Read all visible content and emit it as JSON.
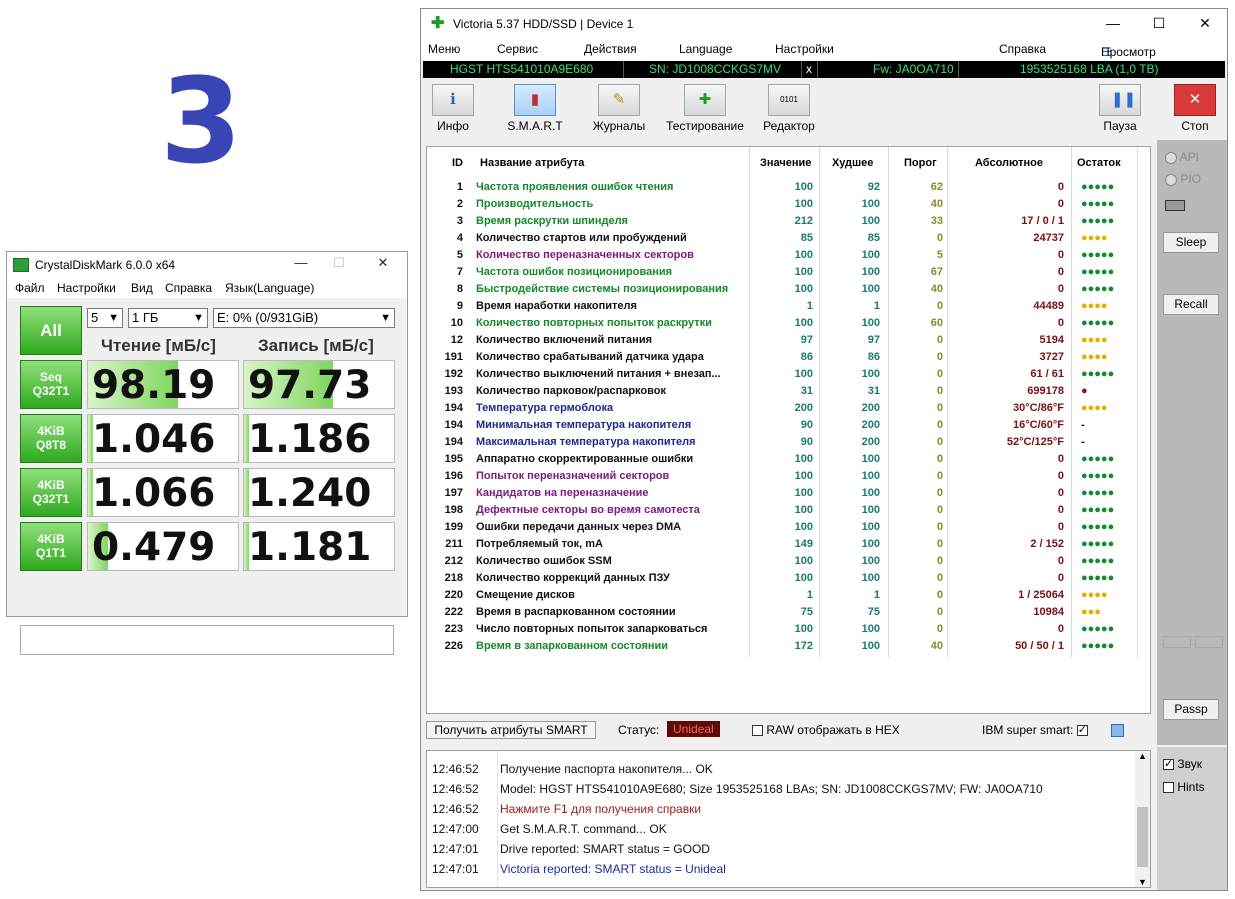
{
  "overlay_number": "3",
  "cdm": {
    "title": "CrystalDiskMark 6.0.0 x64",
    "menu": [
      "Файл",
      "Настройки",
      "Вид",
      "Справка",
      "Язык(Language)"
    ],
    "all_label": "All",
    "count": "5",
    "size": "1 ГБ",
    "drive": "E: 0% (0/931GiB)",
    "read_header": "Чтение [мБ/с]",
    "write_header": "Запись [мБ/с]",
    "rows": [
      {
        "label1": "Seq",
        "label2": "Q32T1",
        "read": "98.19",
        "write": "97.73",
        "read_fill": 0.6,
        "write_fill": 0.59
      },
      {
        "label1": "4KiB",
        "label2": "Q8T8",
        "read": "1.046",
        "write": "1.186",
        "read_fill": 0.03,
        "write_fill": 0.03
      },
      {
        "label1": "4KiB",
        "label2": "Q32T1",
        "read": "1.066",
        "write": "1.240",
        "read_fill": 0.03,
        "write_fill": 0.03
      },
      {
        "label1": "4KiB",
        "label2": "Q1T1",
        "read": "0.479",
        "write": "1.181",
        "read_fill": 0.13,
        "write_fill": 0.03
      }
    ]
  },
  "victoria": {
    "title": "Victoria 5.37 HDD/SSD | Device 1",
    "menu": [
      "Меню",
      "Сервис",
      "Действия",
      "Language",
      "Настройки",
      "Справка"
    ],
    "buffer_view": "Просмотр буфера",
    "drive_model": "HGST HTS541010A9E680",
    "serial": "SN: JD1008CCKGS7MV",
    "close_x": "x",
    "firmware": "Fw: JA0OA710",
    "lba": "1953525168 LBA (1,0 TB)",
    "toolbar": {
      "info": "Инфо",
      "smart": "S.M.A.R.T",
      "logs": "Журналы",
      "test": "Тестирование",
      "editor": "Редактор",
      "pause": "Пауза",
      "stop": "Стоп"
    },
    "columns": [
      "ID",
      "Название атрибута",
      "Значение",
      "Худшее",
      "Порог",
      "Абсолютное",
      "Остаток"
    ],
    "attributes": [
      {
        "id": "1",
        "name": "Частота проявления ошибок чтения",
        "value": "100",
        "worst": "92",
        "thr": "62",
        "abs": "0",
        "rem": "●●●●●",
        "color": "#148a2c",
        "remc": "dots-green"
      },
      {
        "id": "2",
        "name": "Производительность",
        "value": "100",
        "worst": "100",
        "thr": "40",
        "abs": "0",
        "rem": "●●●●●",
        "color": "#148a2c",
        "remc": "dots-green"
      },
      {
        "id": "3",
        "name": "Время раскрутки шпинделя",
        "value": "212",
        "worst": "100",
        "thr": "33",
        "abs": "17 / 0 / 1",
        "rem": "●●●●●",
        "color": "#148a2c",
        "remc": "dots-green"
      },
      {
        "id": "4",
        "name": "Количество стартов или пробуждений",
        "value": "85",
        "worst": "85",
        "thr": "0",
        "abs": "24737",
        "rem": "●●●●",
        "color": "#111111",
        "remc": "dots-yellow"
      },
      {
        "id": "5",
        "name": "Количество переназначенных секторов",
        "value": "100",
        "worst": "100",
        "thr": "5",
        "abs": "0",
        "rem": "●●●●●",
        "color": "#7a1c7a",
        "remc": "dots-green"
      },
      {
        "id": "7",
        "name": "Частота ошибок позиционирования",
        "value": "100",
        "worst": "100",
        "thr": "67",
        "abs": "0",
        "rem": "●●●●●",
        "color": "#148a2c",
        "remc": "dots-green"
      },
      {
        "id": "8",
        "name": "Быстродействие системы позиционирования",
        "value": "100",
        "worst": "100",
        "thr": "40",
        "abs": "0",
        "rem": "●●●●●",
        "color": "#148a2c",
        "remc": "dots-green"
      },
      {
        "id": "9",
        "name": "Время наработки накопителя",
        "value": "1",
        "worst": "1",
        "thr": "0",
        "abs": "44489",
        "rem": "●●●●",
        "color": "#111111",
        "remc": "dots-yellow"
      },
      {
        "id": "10",
        "name": "Количество повторных попыток раскрутки",
        "value": "100",
        "worst": "100",
        "thr": "60",
        "abs": "0",
        "rem": "●●●●●",
        "color": "#148a2c",
        "remc": "dots-green"
      },
      {
        "id": "12",
        "name": "Количество включений питания",
        "value": "97",
        "worst": "97",
        "thr": "0",
        "abs": "5194",
        "rem": "●●●●",
        "color": "#111111",
        "remc": "dots-yellow"
      },
      {
        "id": "191",
        "name": "Количество срабатываний датчика удара",
        "value": "86",
        "worst": "86",
        "thr": "0",
        "abs": "3727",
        "rem": "●●●●",
        "color": "#111111",
        "remc": "dots-yellow"
      },
      {
        "id": "192",
        "name": "Количество выключений питания + внезап...",
        "value": "100",
        "worst": "100",
        "thr": "0",
        "abs": "61 / 61",
        "rem": "●●●●●",
        "color": "#111111",
        "remc": "dots-green"
      },
      {
        "id": "193",
        "name": "Количество парковок/распарковок",
        "value": "31",
        "worst": "31",
        "thr": "0",
        "abs": "699178",
        "rem": "●",
        "color": "#111111",
        "remc": "dots-red"
      },
      {
        "id": "194",
        "name": "Температура гермоблока",
        "value": "200",
        "worst": "200",
        "thr": "0",
        "abs": "30°C/86°F",
        "rem": "●●●●",
        "color": "#1e2a8a",
        "remc": "dots-yellow"
      },
      {
        "id": "194",
        "name": "Минимальная температура накопителя",
        "value": "90",
        "worst": "200",
        "thr": "0",
        "abs": "16°C/60°F",
        "rem": "-",
        "color": "#1e2a8a",
        "remc": "dots-plain"
      },
      {
        "id": "194",
        "name": "Максимальная температура накопителя",
        "value": "90",
        "worst": "200",
        "thr": "0",
        "abs": "52°C/125°F",
        "rem": "-",
        "color": "#1e2a8a",
        "remc": "dots-plain"
      },
      {
        "id": "195",
        "name": "Аппаратно скорректированные ошибки",
        "value": "100",
        "worst": "100",
        "thr": "0",
        "abs": "0",
        "rem": "●●●●●",
        "color": "#111111",
        "remc": "dots-green"
      },
      {
        "id": "196",
        "name": "Попыток переназначений секторов",
        "value": "100",
        "worst": "100",
        "thr": "0",
        "abs": "0",
        "rem": "●●●●●",
        "color": "#7a1c7a",
        "remc": "dots-green"
      },
      {
        "id": "197",
        "name": "Кандидатов на переназначение",
        "value": "100",
        "worst": "100",
        "thr": "0",
        "abs": "0",
        "rem": "●●●●●",
        "color": "#7a1c7a",
        "remc": "dots-green"
      },
      {
        "id": "198",
        "name": "Дефектные секторы во время самотеста",
        "value": "100",
        "worst": "100",
        "thr": "0",
        "abs": "0",
        "rem": "●●●●●",
        "color": "#7a1c7a",
        "remc": "dots-green"
      },
      {
        "id": "199",
        "name": "Ошибки передачи данных через DMA",
        "value": "100",
        "worst": "100",
        "thr": "0",
        "abs": "0",
        "rem": "●●●●●",
        "color": "#111111",
        "remc": "dots-green"
      },
      {
        "id": "211",
        "name": "Потребляемый ток, mA",
        "value": "149",
        "worst": "100",
        "thr": "0",
        "abs": "2 / 152",
        "rem": "●●●●●",
        "color": "#111111",
        "remc": "dots-green"
      },
      {
        "id": "212",
        "name": "Количество ошибок SSM",
        "value": "100",
        "worst": "100",
        "thr": "0",
        "abs": "0",
        "rem": "●●●●●",
        "color": "#111111",
        "remc": "dots-green"
      },
      {
        "id": "218",
        "name": "Количество коррекций данных ПЗУ",
        "value": "100",
        "worst": "100",
        "thr": "0",
        "abs": "0",
        "rem": "●●●●●",
        "color": "#111111",
        "remc": "dots-green"
      },
      {
        "id": "220",
        "name": "Смещение дисков",
        "value": "1",
        "worst": "1",
        "thr": "0",
        "abs": "1 / 25064",
        "rem": "●●●●",
        "color": "#111111",
        "remc": "dots-yellow"
      },
      {
        "id": "222",
        "name": "Время в распаркованном состоянии",
        "value": "75",
        "worst": "75",
        "thr": "0",
        "abs": "10984",
        "rem": "●●●",
        "color": "#111111",
        "remc": "dots-yellow"
      },
      {
        "id": "223",
        "name": "Число повторных попыток запарковаться",
        "value": "100",
        "worst": "100",
        "thr": "0",
        "abs": "0",
        "rem": "●●●●●",
        "color": "#111111",
        "remc": "dots-green"
      },
      {
        "id": "226",
        "name": "Время в запаркованном состоянии",
        "value": "172",
        "worst": "100",
        "thr": "40",
        "abs": "50 / 50 / 1",
        "rem": "●●●●●",
        "color": "#148a2c",
        "remc": "dots-green"
      }
    ],
    "get_smart_button": "Получить атрибуты SMART",
    "status_label": "Статус:",
    "status_value": "Unideal",
    "raw_hex_label": "RAW отображать в HEX",
    "ibm_label": "IBM super smart:",
    "side": {
      "api": "API",
      "pio": "PIO",
      "sleep": "Sleep",
      "recall": "Recall",
      "passp": "Passp",
      "sound": "Звук",
      "hints": "Hints"
    },
    "log": [
      {
        "time": "12:46:52",
        "msg": "Получение паспорта накопителя... OK",
        "color": "#111111"
      },
      {
        "time": "12:46:52",
        "msg": "Model: HGST HTS541010A9E680; Size 1953525168 LBAs; SN: JD1008CCKGS7MV; FW: JA0OA710",
        "color": "#111111"
      },
      {
        "time": "12:46:52",
        "msg": "Нажмите F1 для получения справки",
        "color": "#9a1a1a"
      },
      {
        "time": "12:47:00",
        "msg": "Get S.M.A.R.T. command... OK",
        "color": "#111111"
      },
      {
        "time": "12:47:01",
        "msg": "Drive reported: SMART status = GOOD",
        "color": "#111111"
      },
      {
        "time": "12:47:01",
        "msg": "Victoria reported: SMART status = Unideal",
        "color": "#1e2a9a"
      }
    ]
  }
}
